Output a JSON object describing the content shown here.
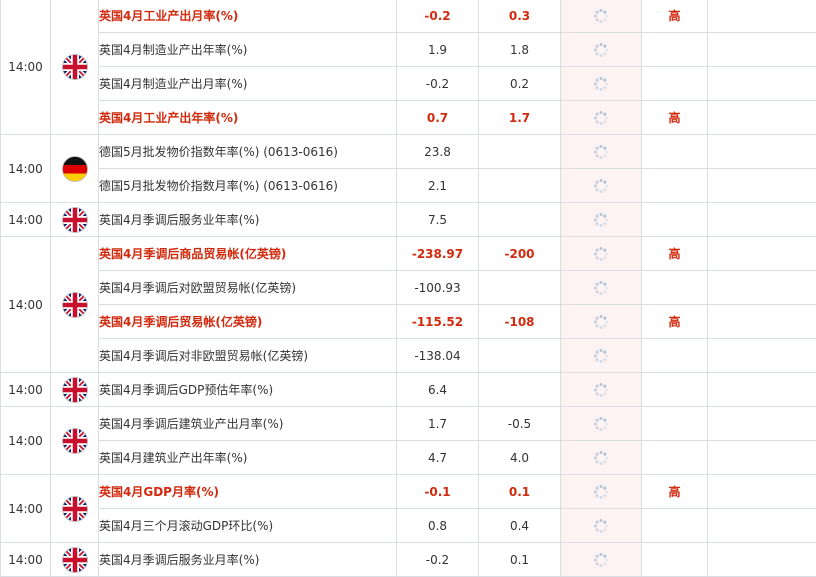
{
  "groups": [
    {
      "time": "14:00",
      "flag": "uk",
      "rows": [
        {
          "name": "英国4月工业产出月率(%)",
          "prev": "-0.2",
          "forecast": "0.3",
          "importance": "高",
          "highlight": true
        },
        {
          "name": "英国4月制造业产出年率(%)",
          "prev": "1.9",
          "forecast": "1.8",
          "importance": "",
          "highlight": false
        },
        {
          "name": "英国4月制造业产出月率(%)",
          "prev": "-0.2",
          "forecast": "0.2",
          "importance": "",
          "highlight": false
        },
        {
          "name": "英国4月工业产出年率(%)",
          "prev": "0.7",
          "forecast": "1.7",
          "importance": "高",
          "highlight": true
        }
      ]
    },
    {
      "time": "14:00",
      "flag": "de",
      "rows": [
        {
          "name": "德国5月批发物价指数年率(%) (0613-0616)",
          "prev": "23.8",
          "forecast": "",
          "importance": "",
          "highlight": false
        },
        {
          "name": "德国5月批发物价指数月率(%) (0613-0616)",
          "prev": "2.1",
          "forecast": "",
          "importance": "",
          "highlight": false
        }
      ]
    },
    {
      "time": "14:00",
      "flag": "uk",
      "rows": [
        {
          "name": "英国4月季调后服务业年率(%)",
          "prev": "7.5",
          "forecast": "",
          "importance": "",
          "highlight": false
        }
      ]
    },
    {
      "time": "14:00",
      "flag": "uk",
      "rows": [
        {
          "name": "英国4月季调后商品贸易帐(亿英镑)",
          "prev": "-238.97",
          "forecast": "-200",
          "importance": "高",
          "highlight": true
        },
        {
          "name": "英国4月季调后对欧盟贸易帐(亿英镑)",
          "prev": "-100.93",
          "forecast": "",
          "importance": "",
          "highlight": false
        },
        {
          "name": "英国4月季调后贸易帐(亿英镑)",
          "prev": "-115.52",
          "forecast": "-108",
          "importance": "高",
          "highlight": true
        },
        {
          "name": "英国4月季调后对非欧盟贸易帐(亿英镑)",
          "prev": "-138.04",
          "forecast": "",
          "importance": "",
          "highlight": false
        }
      ]
    },
    {
      "time": "14:00",
      "flag": "uk",
      "rows": [
        {
          "name": "英国4月季调后GDP预估年率(%)",
          "prev": "6.4",
          "forecast": "",
          "importance": "",
          "highlight": false
        }
      ]
    },
    {
      "time": "14:00",
      "flag": "uk",
      "rows": [
        {
          "name": "英国4月季调后建筑业产出月率(%)",
          "prev": "1.7",
          "forecast": "-0.5",
          "importance": "",
          "highlight": false
        },
        {
          "name": "英国4月建筑业产出年率(%)",
          "prev": "4.7",
          "forecast": "4.0",
          "importance": "",
          "highlight": false
        }
      ]
    },
    {
      "time": "14:00",
      "flag": "uk",
      "rows": [
        {
          "name": "英国4月GDP月率(%)",
          "prev": "-0.1",
          "forecast": "0.1",
          "importance": "高",
          "highlight": true
        },
        {
          "name": "英国4月三个月滚动GDP环比(%)",
          "prev": "0.8",
          "forecast": "0.4",
          "importance": "",
          "highlight": false
        }
      ]
    },
    {
      "time": "14:00",
      "flag": "uk",
      "rows": [
        {
          "name": "英国4月季调后服务业月率(%)",
          "prev": "-0.2",
          "forecast": "0.1",
          "importance": "",
          "highlight": false
        }
      ]
    }
  ],
  "icons": {
    "uk": "uk-flag-icon",
    "de": "germany-flag-icon",
    "pending": "loading-spinner-icon"
  },
  "colors": {
    "highlight": "#d12a0e",
    "pending_bg": "#fdf3f3",
    "border": "#d9dee3"
  }
}
